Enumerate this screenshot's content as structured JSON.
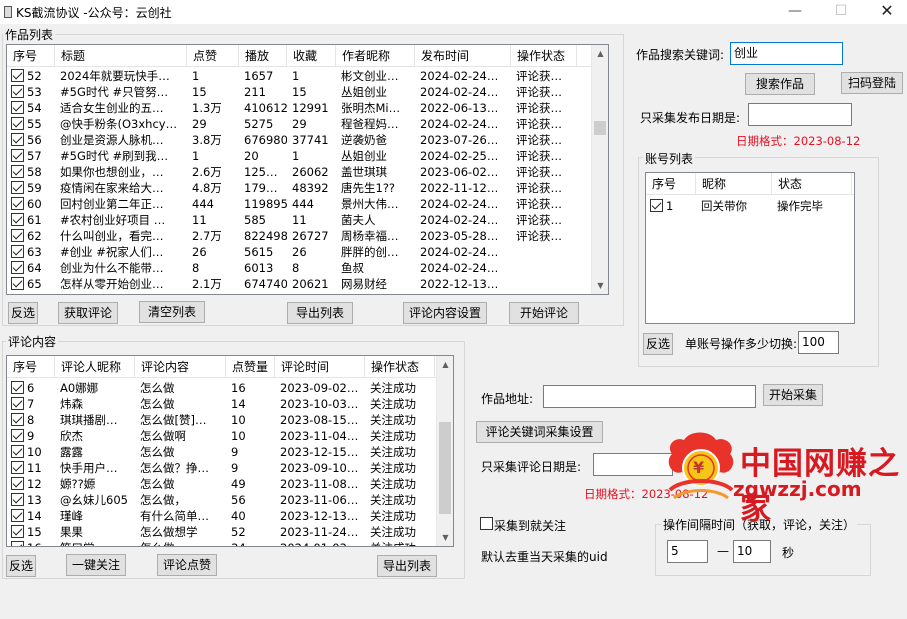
{
  "window": {
    "title": "KS截流协议 -公众号：云创社",
    "min_glyph": "—",
    "max_glyph": "☐",
    "close_glyph": "✕"
  },
  "works": {
    "group_title": "作品列表",
    "columns": [
      "序号",
      "标题",
      "点赞",
      "播放",
      "收藏",
      "作者昵称",
      "发布时间",
      "操作状态"
    ],
    "rows": [
      [
        "52",
        "2024年就要玩快手…",
        "1",
        "1657",
        "1",
        "彬文创业…",
        "2024-02-24…",
        "评论获…"
      ],
      [
        "53",
        "#5G时代  #只管努…",
        "15",
        "211",
        "15",
        "丛姐创业",
        "2024-02-24…",
        "评论获…"
      ],
      [
        "54",
        "适合女生创业的五…",
        "1.3万",
        "410612",
        "12991",
        "张明杰Mi…",
        "2022-06-13…",
        "评论获…"
      ],
      [
        "55",
        "@快手粉条(O3xhcy…",
        "29",
        "5275",
        "29",
        "程爸程妈…",
        "2024-02-24…",
        "评论获…"
      ],
      [
        "56",
        "创业是资源人脉机…",
        "3.8万",
        "676980",
        "37741",
        "逆袭奶爸",
        "2023-07-26…",
        "评论获…"
      ],
      [
        "57",
        "#5G时代  #刷到我…",
        "1",
        "20",
        "1",
        "丛姐创业",
        "2024-02-25…",
        "评论获…"
      ],
      [
        "58",
        "如果你也想创业，…",
        "2.6万",
        "125…",
        "26062",
        "盖世琪琪",
        "2023-06-02…",
        "评论获…"
      ],
      [
        "59",
        "疫情闲在家来给大…",
        "4.8万",
        "179…",
        "48392",
        "唐先生1??",
        "2022-11-12…",
        "评论获…"
      ],
      [
        "60",
        "回村创业第二年正…",
        "444",
        "119895",
        "444",
        "景州大伟…",
        "2024-02-24…",
        "评论获…"
      ],
      [
        "61",
        "#农村创业好项目 …",
        "11",
        "585",
        "11",
        "菌夫人",
        "2024-02-24…",
        "评论获…"
      ],
      [
        "62",
        "什么叫创业，看完…",
        "2.7万",
        "822498",
        "26727",
        "周杨幸福…",
        "2023-05-28…",
        "评论获…"
      ],
      [
        "63",
        "#创业 #祝家人们…",
        "26",
        "5615",
        "26",
        "胖胖的创…",
        "2024-02-24…",
        ""
      ],
      [
        "64",
        "创业为什么不能带…",
        "8",
        "6013",
        "8",
        "鱼叔",
        "2024-02-24…",
        ""
      ],
      [
        "65",
        "怎样从零开始创业…",
        "2.1万",
        "674740",
        "20621",
        "网易财经",
        "2022-12-13…",
        ""
      ]
    ],
    "buttons": {
      "invert": "反选",
      "get_comments": "获取评论",
      "clear_list": "清空列表",
      "export_list": "导出列表",
      "comment_settings": "评论内容设置",
      "start_comment": "开始评论"
    }
  },
  "search": {
    "keyword_label": "作品搜索关键词:",
    "keyword_value": "创业",
    "search_button": "搜索作品",
    "scan_login_button": "扫码登陆",
    "date_label": "只采集发布日期是:",
    "date_value": "",
    "date_hint": "日期格式：2023-08-12"
  },
  "accounts": {
    "group_title": "账号列表",
    "columns": [
      "序号",
      "昵称",
      "状态"
    ],
    "rows": [
      [
        "1",
        "回关带你",
        "操作完毕"
      ]
    ],
    "invert_button": "反选",
    "switch_label": "单账号操作多少切换:",
    "switch_value": "100"
  },
  "comments": {
    "group_title": "评论内容",
    "columns": [
      "序号",
      "评论人昵称",
      "评论内容",
      "点赞量",
      "评论时间",
      "操作状态"
    ],
    "rows": [
      [
        "6",
        "A0娜娜",
        "怎么做",
        "16",
        "2023-09-02…",
        "关注成功"
      ],
      [
        "7",
        "炜森",
        "怎么做",
        "14",
        "2023-10-03…",
        "关注成功"
      ],
      [
        "8",
        "琪琪播剧…",
        "怎么做[赞]…",
        "10",
        "2023-08-15…",
        "关注成功"
      ],
      [
        "9",
        "欣杰",
        "怎么做啊",
        "10",
        "2023-11-04…",
        "关注成功"
      ],
      [
        "10",
        "露露",
        "怎么做",
        "9",
        "2023-12-15…",
        "关注成功"
      ],
      [
        "11",
        "快手用户…",
        "怎么做？挣…",
        "9",
        "2023-09-10…",
        "关注成功"
      ],
      [
        "12",
        "嫄??嫄",
        "怎么做",
        "49",
        "2023-11-08…",
        "关注成功"
      ],
      [
        "13",
        "@幺妹儿605",
        "怎么做，",
        "56",
        "2023-11-06…",
        "关注成功"
      ],
      [
        "14",
        "瑾峰",
        "有什么简单…",
        "40",
        "2023-12-13…",
        "关注成功"
      ],
      [
        "15",
        "果果",
        "怎么做想学",
        "52",
        "2023-11-24…",
        "关注成功"
      ],
      [
        "16",
        "笑口常…",
        "怎么做",
        "34",
        "2024-01-03…",
        "关注成功"
      ]
    ],
    "buttons": {
      "invert": "反选",
      "follow_all": "一键关注",
      "like_comments": "评论点赞",
      "export_list": "导出列表"
    }
  },
  "collect": {
    "url_label": "作品地址:",
    "url_value": "",
    "start_button": "开始采集",
    "keyword_settings_button": "评论关键词采集设置",
    "date_label": "只采集评论日期是:",
    "date_value": "",
    "date_hint": "日期格式：2023-08-12",
    "follow_on_collect_label": "采集到就关注",
    "dedupe_label": "默认去重当天采集的uid"
  },
  "interval": {
    "group_title": "操作间隔时间（获取，评论，关注）",
    "from_value": "5",
    "dash": "—",
    "to_value": "10",
    "unit": "秒"
  },
  "watermark": {
    "cn_text": "中国网赚之家",
    "en_text": "zgwzzj.com",
    "coin_glyph": "¥"
  }
}
